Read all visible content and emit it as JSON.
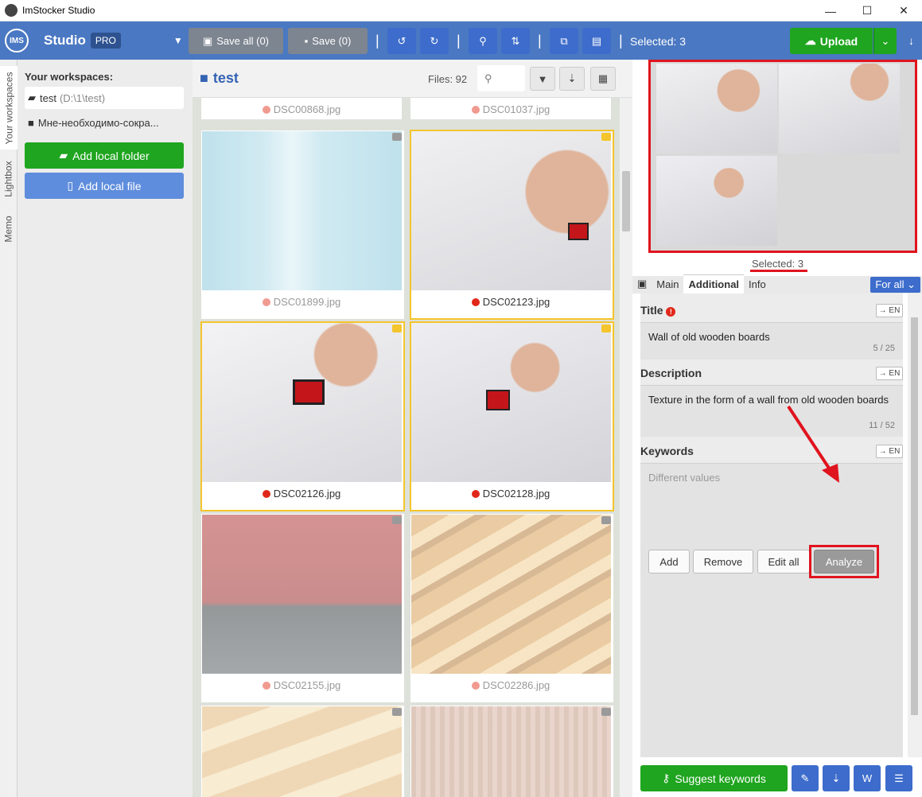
{
  "window": {
    "title": "ImStocker Studio",
    "logo": "IMS",
    "minimize": "—",
    "maximize": "☐",
    "close": "✕"
  },
  "toolbar": {
    "studio": "Studio",
    "pro": "PRO",
    "save_all": "Save all (0)",
    "save": "Save (0)",
    "selected": "Selected: 3",
    "upload": "Upload"
  },
  "vtabs": {
    "workspaces": "Your workspaces",
    "lightbox": "Lightbox",
    "memo": "Memo"
  },
  "workspaces": {
    "heading": "Your workspaces:",
    "items": [
      {
        "name": "test",
        "path": "(D:\\1\\test)"
      },
      {
        "name": "Мне-необходимо-сокра..."
      }
    ],
    "add_folder": "Add local folder",
    "add_file": "Add local file"
  },
  "gallery": {
    "folder": "test",
    "files": "Files: 92",
    "top_names": [
      "DSC00868.jpg",
      "DSC01037.jpg"
    ],
    "cards": [
      {
        "name": "DSC01899.jpg"
      },
      {
        "name": "DSC02123.jpg"
      },
      {
        "name": "DSC02126.jpg"
      },
      {
        "name": "DSC02128.jpg"
      },
      {
        "name": "DSC02155.jpg"
      },
      {
        "name": "DSC02286.jpg"
      }
    ]
  },
  "panel": {
    "selected_prefix": "Selected: ",
    "selected_count": "3",
    "tabs": [
      "Main",
      "Additional",
      "Info"
    ],
    "for_all": "For all",
    "title_label": "Title",
    "title_value": "Wall of old wooden boards",
    "title_count": "5 / 25",
    "desc_label": "Description",
    "desc_value": "Texture in the form of a wall from old wooden boards",
    "desc_count": "11 / 52",
    "kw_label": "Keywords",
    "kw_placeholder": "Different values",
    "lang": "→ EN",
    "add": "Add",
    "remove": "Remove",
    "edit_all": "Edit all",
    "analyze": "Analyze",
    "suggest": "Suggest keywords"
  },
  "colors": {
    "accent": "#4a78c2",
    "green": "#1fa51f",
    "highlight": "#e0141e",
    "selected": "#f4c52c"
  }
}
